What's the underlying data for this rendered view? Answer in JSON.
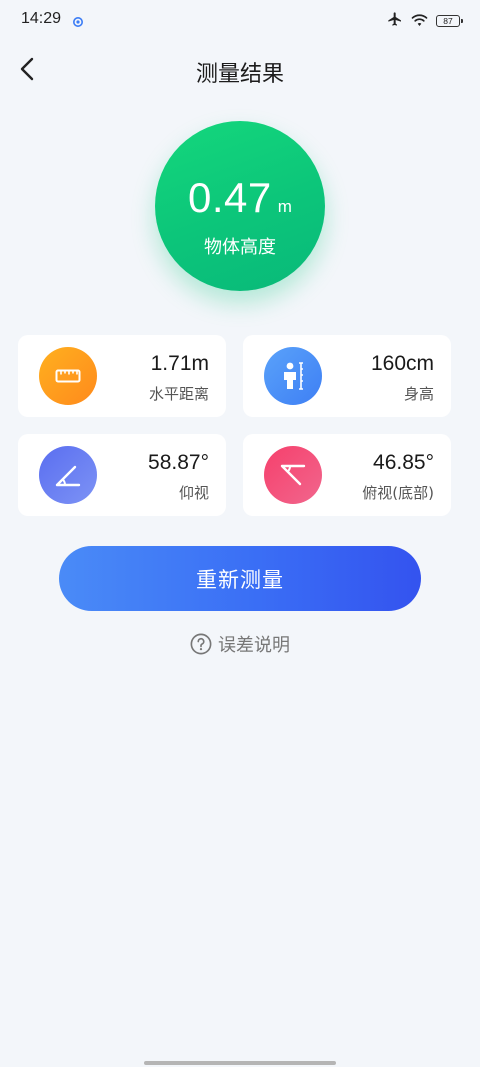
{
  "status_bar": {
    "time": "14:29",
    "battery": "87"
  },
  "header": {
    "title": "测量结果"
  },
  "result": {
    "value": "0.47",
    "unit": "m",
    "label": "物体高度"
  },
  "cards": [
    {
      "value": "1.71m",
      "label": "水平距离",
      "icon": "ruler-icon",
      "color": "#ff9a1f"
    },
    {
      "value": "160cm",
      "label": "身高",
      "icon": "person-height-icon",
      "color": "#4f93f7"
    },
    {
      "value": "58.87°",
      "label": "仰视",
      "icon": "elevation-angle-icon",
      "color": "#6a7ff2"
    },
    {
      "value": "46.85°",
      "label": "俯视(底部)",
      "icon": "depression-angle-icon",
      "color": "#f54c77"
    }
  ],
  "actions": {
    "remeasure_label": "重新测量",
    "error_info_label": "误差说明"
  },
  "colors": {
    "background": "#f3f6fa",
    "result_green": "#0cc57a",
    "button_blue": "#3a6ef5"
  }
}
